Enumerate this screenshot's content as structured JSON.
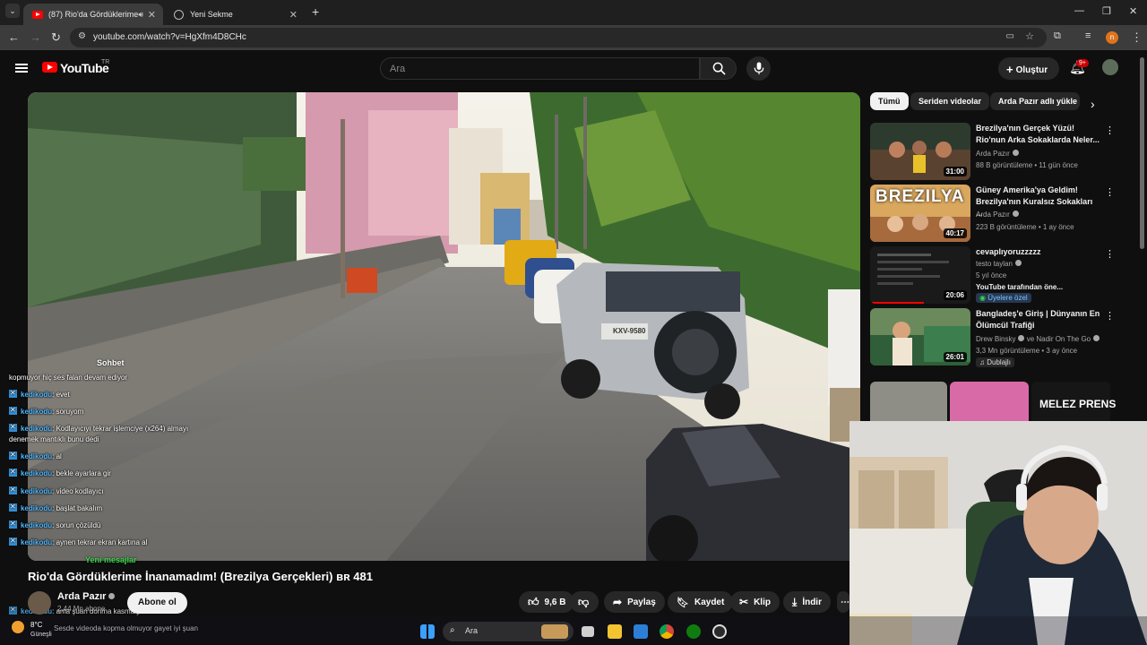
{
  "browser": {
    "tabs": [
      {
        "title": "(87) Rio'da Gördüklerime İn",
        "active": true
      },
      {
        "title": "Yeni Sekme",
        "active": false
      }
    ],
    "new_tab": "+",
    "url": "youtube.com/watch?v=HgXfm4D8CHc",
    "profile_initial": "n"
  },
  "youtube": {
    "logo_text": "YouTube",
    "country": "TR",
    "search_placeholder": "Ara",
    "create_label": "Oluştur",
    "notif_count": "9+"
  },
  "video": {
    "title": "Rio'da Gördüklerime İnanamadım! (Brezilya Gerçekleri) ʙʀ 481",
    "channel": "Arda Pazır",
    "subscribe_label": "Abone ol",
    "subs": "2,44 Mn abone",
    "likes": "9,6 B",
    "share": "Paylaş",
    "save": "Kaydet",
    "clip": "Klip",
    "download": "İndir",
    "plate": "KXV-9580"
  },
  "chat": {
    "header": "Sohbet",
    "new_messages": "Yeni mesajlar",
    "lines": [
      {
        "user": "",
        "text": "kopmuyor hiç ses falan devam ediyor"
      },
      {
        "user": "kedikodu",
        "text": ": evet"
      },
      {
        "user": "kedikodu",
        "text": ": soruyom"
      },
      {
        "user": "kedikodu",
        "text": ": Kodlayıcıyı tekrar işlemciye (x264) almayı"
      },
      {
        "user": "",
        "text": "denemek mantıklı bunu dedi"
      },
      {
        "user": "kedikodu",
        "text": ": al"
      },
      {
        "user": "kedikodu",
        "text": ": bekle ayarlara gir"
      },
      {
        "user": "kedikodu",
        "text": ": video kodlayıcı"
      },
      {
        "user": "kedikodu",
        "text": ": başlat bakalım"
      },
      {
        "user": "kedikodu",
        "text": ": sorun çözüldü"
      },
      {
        "user": "kedikodu",
        "text": ": aynen tekrar ekran kartına al"
      },
      {
        "user": "kedikodu",
        "text": ": ama şuan donma kasma yok"
      },
      {
        "user": "",
        "text": "Sesde videoda kopma olmuyor gayet iyi şuan"
      }
    ]
  },
  "sidebar": {
    "chips": [
      "Tümü",
      "Seriden videolar",
      "Arda Pazır adlı yükle"
    ],
    "recommendations": [
      {
        "title": "Brezilya'nın Gerçek Yüzü! Rio'nun Arka Sokaklarda Neler...",
        "channel": "Arda Pazır",
        "meta": "88 B görüntüleme • 11 gün önce",
        "duration": "31:00"
      },
      {
        "title": "Güney Amerika'ya Geldim! Brezilya'nın Kuralsız Sokakları ...",
        "channel": "Arda Pazır",
        "meta": "223 B görüntüleme • 1 ay önce",
        "duration": "40:17",
        "thumb_text": "BREZILYA"
      },
      {
        "title": "cevaplıyoruzzzzz",
        "channel": "testo taylan",
        "meta": "5 yıl önce",
        "extra": "YouTube tarafından öne...",
        "badge": "Üyelere özel",
        "duration": "20:06"
      },
      {
        "title": "Bangladeş'e Giriş | Dünyanın En Ölümcül Trafiği",
        "channel": "Drew Binsky",
        "channel2": "ve Nadir On The Go",
        "meta": "3,3 Mn görüntüleme • 3 ay önce",
        "badge": "Dublajlı",
        "duration": "26:01"
      }
    ],
    "shorts_label": "MELEZ PRENS"
  },
  "taskbar": {
    "weather_temp": "8°C",
    "weather_text": "Güneşli",
    "search": "Ara"
  },
  "colors": {
    "bg": "#0f0f0f",
    "accent_red": "#ff0000",
    "chat_user": "#4fb8ff",
    "new_msg": "#3ad64a"
  }
}
